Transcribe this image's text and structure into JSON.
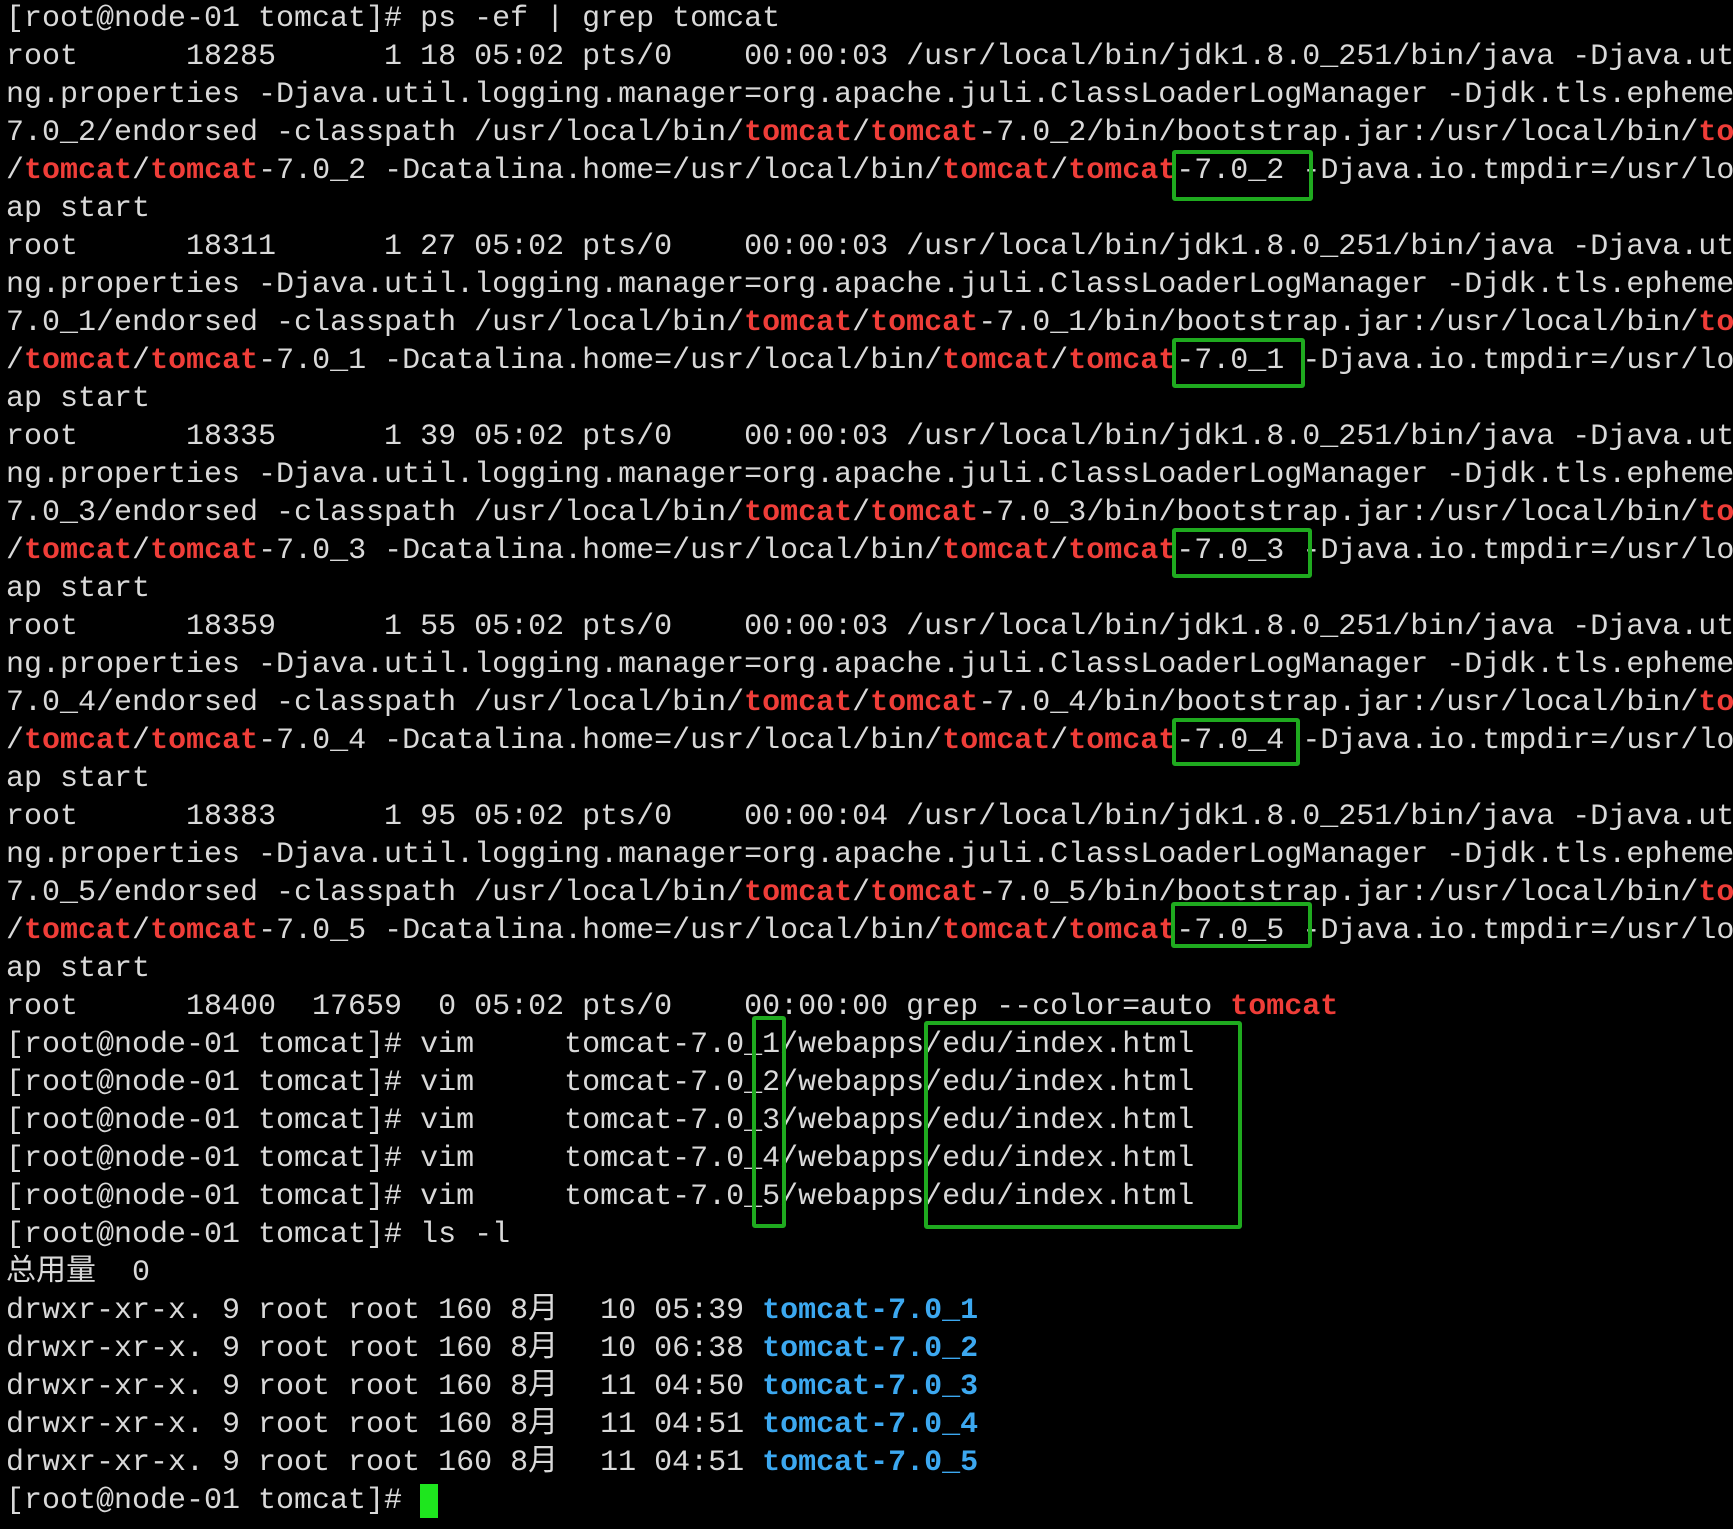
{
  "terminal": {
    "palette": {
      "background": "#000000",
      "text": "#d9d9d9",
      "match": "#ef3d38",
      "directory": "#3ca8f0",
      "annotation_box": "#1faa1f",
      "cursor": "#1ee61e"
    },
    "lines": [
      [
        {
          "text": "[root@node-01 tomcat]# "
        },
        {
          "text": "ps -ef | grep tomcat"
        }
      ],
      [
        {
          "text": "root      18285      1 18 05:02 pts/0    00:00:03 /usr/local/bin/jdk1.8.0_251/bin/java -Djava.ut"
        }
      ],
      [
        {
          "text": "ng.properties -Djava.util.logging.manager=org.apache.juli.ClassLoaderLogManager -Djdk.tls.epheme"
        }
      ],
      [
        {
          "text": "7.0_2/endorsed -classpath /usr/local/bin/"
        },
        {
          "text": "tomcat",
          "color": "#ef3d38"
        },
        {
          "text": "/"
        },
        {
          "text": "tomcat",
          "color": "#ef3d38"
        },
        {
          "text": "-7.0_2/bin/bootstrap.jar:/usr/local/bin/"
        },
        {
          "text": "to",
          "color": "#ef3d38"
        }
      ],
      [
        {
          "text": "/"
        },
        {
          "text": "tomcat",
          "color": "#ef3d38"
        },
        {
          "text": "/"
        },
        {
          "text": "tomcat",
          "color": "#ef3d38"
        },
        {
          "text": "-7.0_2 -Dcatalina.home=/usr/local/bin/"
        },
        {
          "text": "tomcat",
          "color": "#ef3d38"
        },
        {
          "text": "/"
        },
        {
          "text": "tomcat",
          "color": "#ef3d38"
        },
        {
          "text": "-7.0_2 -Djava.io.tmpdir=/usr/lo"
        }
      ],
      [
        {
          "text": "ap start"
        }
      ],
      [
        {
          "text": "root      18311      1 27 05:02 pts/0    00:00:03 /usr/local/bin/jdk1.8.0_251/bin/java -Djava.ut"
        }
      ],
      [
        {
          "text": "ng.properties -Djava.util.logging.manager=org.apache.juli.ClassLoaderLogManager -Djdk.tls.epheme"
        }
      ],
      [
        {
          "text": "7.0_1/endorsed -classpath /usr/local/bin/"
        },
        {
          "text": "tomcat",
          "color": "#ef3d38"
        },
        {
          "text": "/"
        },
        {
          "text": "tomcat",
          "color": "#ef3d38"
        },
        {
          "text": "-7.0_1/bin/bootstrap.jar:/usr/local/bin/"
        },
        {
          "text": "to",
          "color": "#ef3d38"
        }
      ],
      [
        {
          "text": "/"
        },
        {
          "text": "tomcat",
          "color": "#ef3d38"
        },
        {
          "text": "/"
        },
        {
          "text": "tomcat",
          "color": "#ef3d38"
        },
        {
          "text": "-7.0_1 -Dcatalina.home=/usr/local/bin/"
        },
        {
          "text": "tomcat",
          "color": "#ef3d38"
        },
        {
          "text": "/"
        },
        {
          "text": "tomcat",
          "color": "#ef3d38"
        },
        {
          "text": "-7.0_1 -Djava.io.tmpdir=/usr/lo"
        }
      ],
      [
        {
          "text": "ap start"
        }
      ],
      [
        {
          "text": "root      18335      1 39 05:02 pts/0    00:00:03 /usr/local/bin/jdk1.8.0_251/bin/java -Djava.ut"
        }
      ],
      [
        {
          "text": "ng.properties -Djava.util.logging.manager=org.apache.juli.ClassLoaderLogManager -Djdk.tls.epheme"
        }
      ],
      [
        {
          "text": "7.0_3/endorsed -classpath /usr/local/bin/"
        },
        {
          "text": "tomcat",
          "color": "#ef3d38"
        },
        {
          "text": "/"
        },
        {
          "text": "tomcat",
          "color": "#ef3d38"
        },
        {
          "text": "-7.0_3/bin/bootstrap.jar:/usr/local/bin/"
        },
        {
          "text": "to",
          "color": "#ef3d38"
        }
      ],
      [
        {
          "text": "/"
        },
        {
          "text": "tomcat",
          "color": "#ef3d38"
        },
        {
          "text": "/"
        },
        {
          "text": "tomcat",
          "color": "#ef3d38"
        },
        {
          "text": "-7.0_3 -Dcatalina.home=/usr/local/bin/"
        },
        {
          "text": "tomcat",
          "color": "#ef3d38"
        },
        {
          "text": "/"
        },
        {
          "text": "tomcat",
          "color": "#ef3d38"
        },
        {
          "text": "-7.0_3 -Djava.io.tmpdir=/usr/lo"
        }
      ],
      [
        {
          "text": "ap start"
        }
      ],
      [
        {
          "text": "root      18359      1 55 05:02 pts/0    00:00:03 /usr/local/bin/jdk1.8.0_251/bin/java -Djava.ut"
        }
      ],
      [
        {
          "text": "ng.properties -Djava.util.logging.manager=org.apache.juli.ClassLoaderLogManager -Djdk.tls.epheme"
        }
      ],
      [
        {
          "text": "7.0_4/endorsed -classpath /usr/local/bin/"
        },
        {
          "text": "tomcat",
          "color": "#ef3d38"
        },
        {
          "text": "/"
        },
        {
          "text": "tomcat",
          "color": "#ef3d38"
        },
        {
          "text": "-7.0_4/bin/bootstrap.jar:/usr/local/bin/"
        },
        {
          "text": "to",
          "color": "#ef3d38"
        }
      ],
      [
        {
          "text": "/"
        },
        {
          "text": "tomcat",
          "color": "#ef3d38"
        },
        {
          "text": "/"
        },
        {
          "text": "tomcat",
          "color": "#ef3d38"
        },
        {
          "text": "-7.0_4 -Dcatalina.home=/usr/local/bin/"
        },
        {
          "text": "tomcat",
          "color": "#ef3d38"
        },
        {
          "text": "/"
        },
        {
          "text": "tomcat",
          "color": "#ef3d38"
        },
        {
          "text": "-7.0_4 -Djava.io.tmpdir=/usr/lo"
        }
      ],
      [
        {
          "text": "ap start"
        }
      ],
      [
        {
          "text": "root      18383      1 95 05:02 pts/0    00:00:04 /usr/local/bin/jdk1.8.0_251/bin/java -Djava.ut"
        }
      ],
      [
        {
          "text": "ng.properties -Djava.util.logging.manager=org.apache.juli.ClassLoaderLogManager -Djdk.tls.epheme"
        }
      ],
      [
        {
          "text": "7.0_5/endorsed -classpath /usr/local/bin/"
        },
        {
          "text": "tomcat",
          "color": "#ef3d38"
        },
        {
          "text": "/"
        },
        {
          "text": "tomcat",
          "color": "#ef3d38"
        },
        {
          "text": "-7.0_5/bin/bootstrap.jar:/usr/local/bin/"
        },
        {
          "text": "to",
          "color": "#ef3d38"
        }
      ],
      [
        {
          "text": "/"
        },
        {
          "text": "tomcat",
          "color": "#ef3d38"
        },
        {
          "text": "/"
        },
        {
          "text": "tomcat",
          "color": "#ef3d38"
        },
        {
          "text": "-7.0_5 -Dcatalina.home=/usr/local/bin/"
        },
        {
          "text": "tomcat",
          "color": "#ef3d38"
        },
        {
          "text": "/"
        },
        {
          "text": "tomcat",
          "color": "#ef3d38"
        },
        {
          "text": "-7.0_5 -Djava.io.tmpdir=/usr/lo"
        }
      ],
      [
        {
          "text": "ap start"
        }
      ],
      [
        {
          "text": "root      18400  17659  0 05:02 pts/0    00:00:00 grep --color=auto "
        },
        {
          "text": "tomcat",
          "color": "#ef3d38"
        }
      ],
      [
        {
          "text": "[root@node-01 tomcat]# "
        },
        {
          "text": "vim     tomcat-7.0_1/webapps/edu/index.html"
        }
      ],
      [
        {
          "text": "[root@node-01 tomcat]# "
        },
        {
          "text": "vim     tomcat-7.0_2/webapps/edu/index.html"
        }
      ],
      [
        {
          "text": "[root@node-01 tomcat]# "
        },
        {
          "text": "vim     tomcat-7.0_3/webapps/edu/index.html"
        }
      ],
      [
        {
          "text": "[root@node-01 tomcat]# "
        },
        {
          "text": "vim     tomcat-7.0_4/webapps/edu/index.html"
        }
      ],
      [
        {
          "text": "[root@node-01 tomcat]# "
        },
        {
          "text": "vim     tomcat-7.0_5/webapps/edu/index.html"
        }
      ],
      [
        {
          "text": "[root@node-01 tomcat]# "
        },
        {
          "text": "ls -l"
        }
      ],
      [
        {
          "text": "总用量"
        },
        {
          "text": " 0"
        }
      ],
      [
        {
          "text": "drwxr-xr-x. 9 root root 160 8"
        },
        {
          "text": "月"
        },
        {
          "text": "  10 05:39 "
        },
        {
          "text": "tomcat-7.0_1",
          "color": "#3ca8f0"
        }
      ],
      [
        {
          "text": "drwxr-xr-x. 9 root root 160 8"
        },
        {
          "text": "月"
        },
        {
          "text": "  10 06:38 "
        },
        {
          "text": "tomcat-7.0_2",
          "color": "#3ca8f0"
        }
      ],
      [
        {
          "text": "drwxr-xr-x. 9 root root 160 8"
        },
        {
          "text": "月"
        },
        {
          "text": "  11 04:50 "
        },
        {
          "text": "tomcat-7.0_3",
          "color": "#3ca8f0"
        }
      ],
      [
        {
          "text": "drwxr-xr-x. 9 root root 160 8"
        },
        {
          "text": "月"
        },
        {
          "text": "  11 04:51 "
        },
        {
          "text": "tomcat-7.0_4",
          "color": "#3ca8f0"
        }
      ],
      [
        {
          "text": "drwxr-xr-x. 9 root root 160 8"
        },
        {
          "text": "月"
        },
        {
          "text": "  11 04:51 "
        },
        {
          "text": "tomcat-7.0_5",
          "color": "#3ca8f0"
        }
      ],
      [
        {
          "text": "[root@node-01 tomcat]# "
        }
      ]
    ]
  }
}
